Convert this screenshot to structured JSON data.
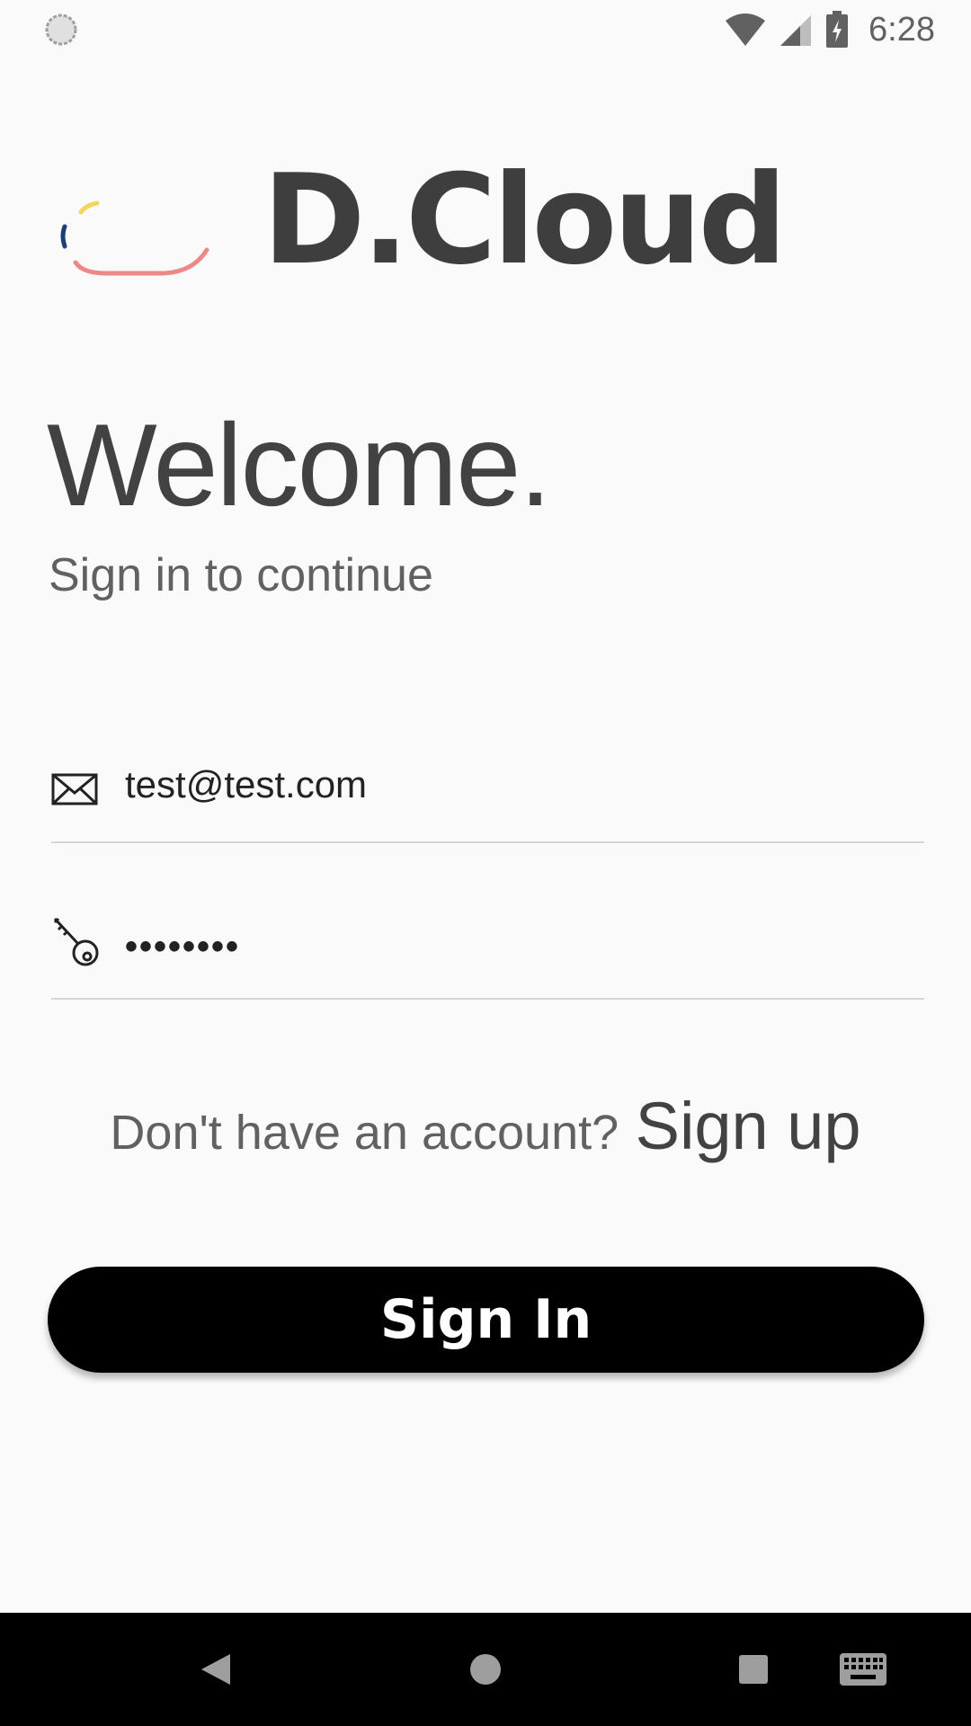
{
  "status_bar": {
    "time": "6:28",
    "left_icon": "sync-icon",
    "icons": [
      "wifi-icon",
      "cell-signal-icon",
      "battery-charging-icon"
    ]
  },
  "app": {
    "brand_name": "D.Cloud",
    "logo_icon": "cloud-logo-icon",
    "logo_colors": [
      "#f4d35e",
      "#1f3d7a",
      "#ee8787"
    ]
  },
  "welcome": {
    "title": "Welcome.",
    "subtitle": "Sign in to continue"
  },
  "form": {
    "email": {
      "value": "test@test.com",
      "icon": "envelope-icon"
    },
    "password": {
      "value": "••••••••",
      "icon": "key-icon"
    }
  },
  "signup": {
    "prompt": "Don't have an account?",
    "link_label": "Sign up"
  },
  "actions": {
    "signin_label": "Sign In"
  },
  "nav_bar": {
    "icons": [
      "back-icon",
      "home-icon",
      "recents-icon",
      "keyboard-icon"
    ]
  }
}
